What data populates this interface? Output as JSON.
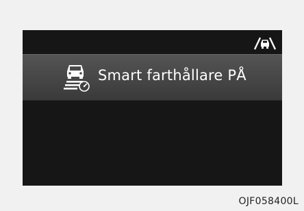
{
  "display": {
    "status_icon": "lane-assist-car-icon",
    "banner": {
      "icon": "smart-cruise-control-icon",
      "text": "Smart farthållare PÅ"
    }
  },
  "image_code": "OJF058400L",
  "colors": {
    "screen_bg": "#161616",
    "banner_bg": "#4a4a4a",
    "text": "#ffffff",
    "page_bg": "#f1f1f1"
  }
}
